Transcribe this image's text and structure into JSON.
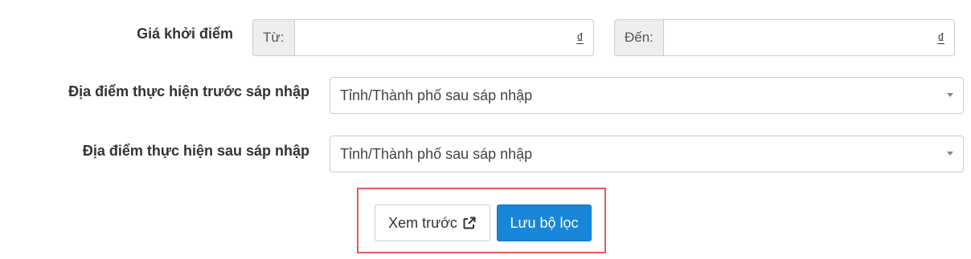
{
  "price_filter": {
    "label": "Giá khởi điểm",
    "from_addon": "Từ:",
    "from_value": "",
    "to_addon": "Đến:",
    "to_value": "",
    "currency_symbol": "₫"
  },
  "location_before": {
    "label": "Địa điểm thực hiện trước sáp nhập",
    "selected": "Tỉnh/Thành phố sau sáp nhập"
  },
  "location_after": {
    "label": "Địa điểm thực hiện sau sáp nhập",
    "selected": "Tỉnh/Thành phố sau sáp nhập"
  },
  "actions": {
    "preview_label": "Xem trước",
    "preview_icon": "external-link-icon",
    "save_filter_label": "Lưu bộ lọc"
  },
  "colors": {
    "primary": "#1886d9",
    "highlight_border": "#e35a5f"
  }
}
